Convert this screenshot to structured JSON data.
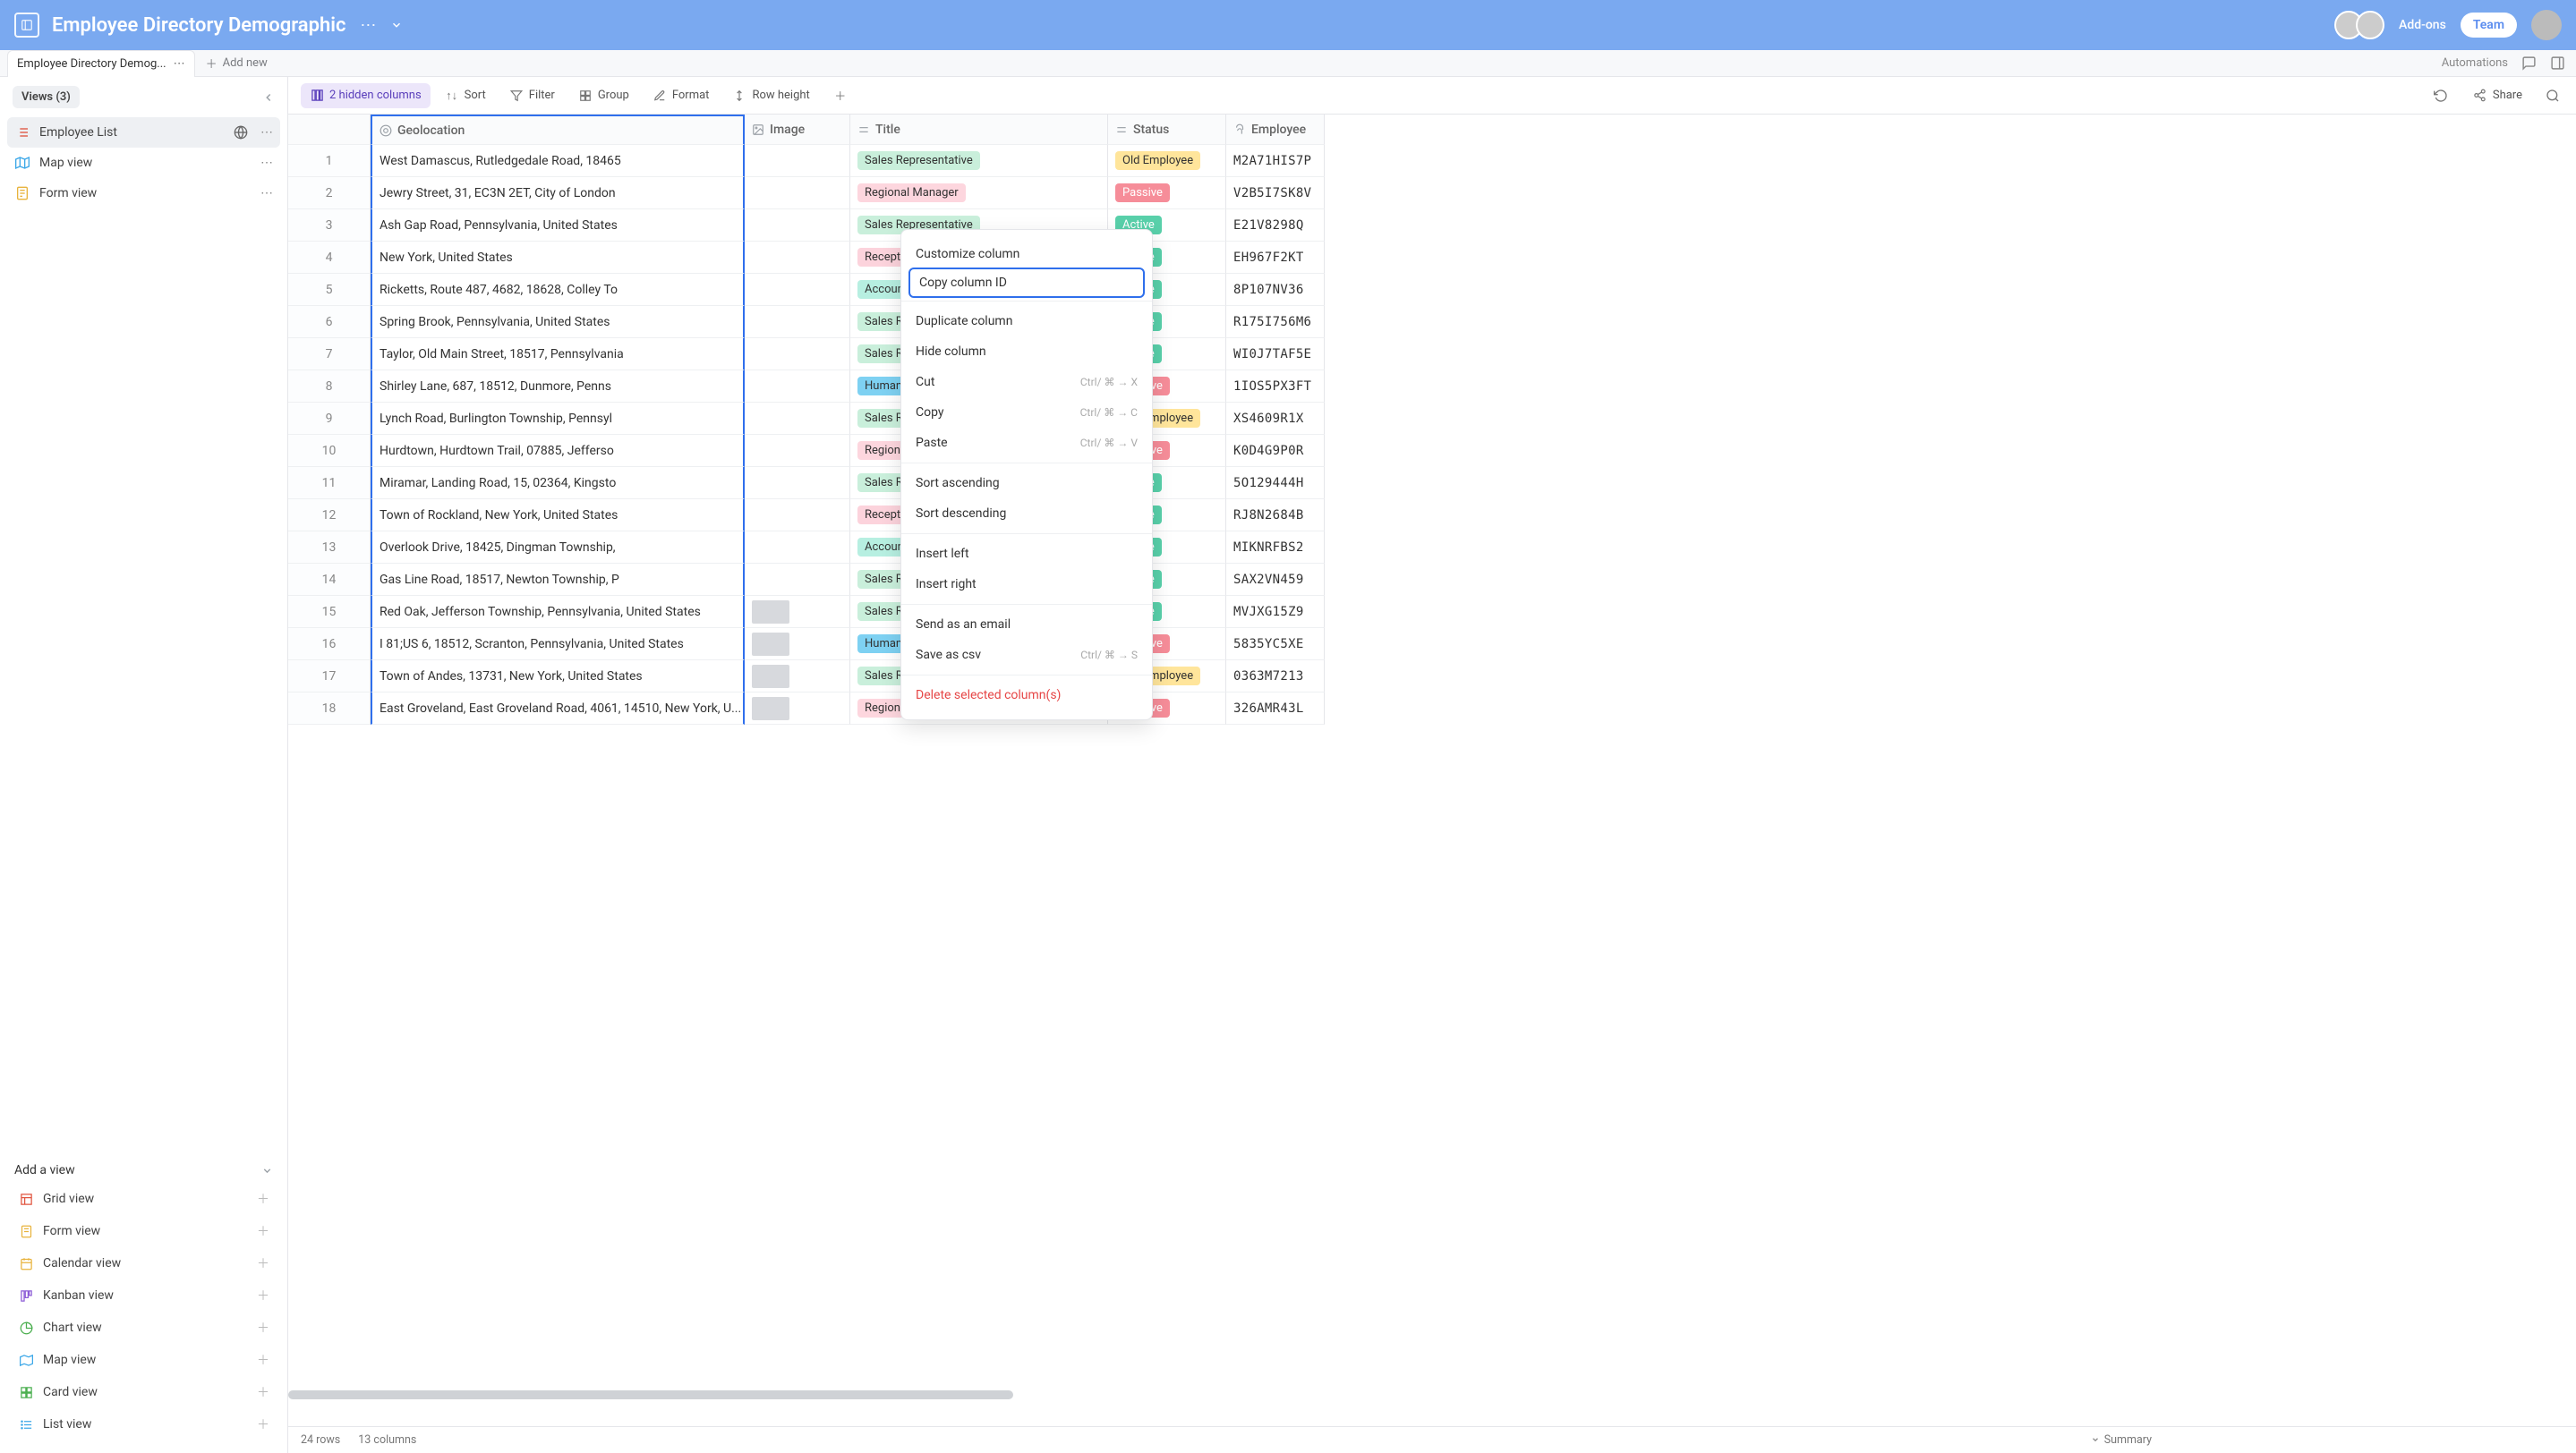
{
  "topbar": {
    "title": "Employee Directory Demographic",
    "addons": "Add-ons",
    "team": "Team"
  },
  "tabstrip": {
    "tab_name": "Employee Directory Demog...",
    "add_new": "Add new",
    "automations": "Automations"
  },
  "sidebar": {
    "views_label": "Views (3)",
    "items": [
      {
        "label": "Employee List"
      },
      {
        "label": "Map view"
      },
      {
        "label": "Form view"
      }
    ],
    "add_view_label": "Add a view",
    "add_view_items": [
      {
        "label": "Grid view"
      },
      {
        "label": "Form view"
      },
      {
        "label": "Calendar view"
      },
      {
        "label": "Kanban view"
      },
      {
        "label": "Chart view"
      },
      {
        "label": "Map view"
      },
      {
        "label": "Card view"
      },
      {
        "label": "List view"
      }
    ]
  },
  "toolbar": {
    "hidden": "2 hidden columns",
    "sort": "Sort",
    "filter": "Filter",
    "group": "Group",
    "format": "Format",
    "row_height": "Row height",
    "share": "Share"
  },
  "columns": {
    "c1": "Geolocation",
    "c2": "Image",
    "c3": "Title",
    "c4": "Status",
    "c5": "Employee"
  },
  "rows": [
    {
      "n": "1",
      "geo": "West Damascus, Rutledgedale Road, 18465",
      "title": "Sales Representative",
      "status": "Old Employee",
      "emp": "M2A71HIS7P"
    },
    {
      "n": "2",
      "geo": "Jewry Street, 31, EC3N 2ET, City of London",
      "title": "Regional Manager",
      "status": "Passive",
      "emp": "V2B5I7SK8V"
    },
    {
      "n": "3",
      "geo": "Ash Gap Road, Pennsylvania, United States",
      "title": "Sales Representative",
      "status": "Active",
      "emp": "E21V8298Q"
    },
    {
      "n": "4",
      "geo": "New York, United States",
      "title": "Receptionist",
      "status": "Active",
      "emp": "EH967F2KT"
    },
    {
      "n": "5",
      "geo": "Ricketts, Route 487, 4682, 18628, Colley To",
      "title": "Accountant",
      "status": "Active",
      "emp": "8P107NV36"
    },
    {
      "n": "6",
      "geo": "Spring Brook, Pennsylvania, United States",
      "title": "Sales Representative",
      "status": "Active",
      "emp": "R175I756M6"
    },
    {
      "n": "7",
      "geo": "Taylor, Old Main Street, 18517, Pennsylvania",
      "title": "Sales Representative",
      "status": "Active",
      "emp": "WI0J7TAF5E"
    },
    {
      "n": "8",
      "geo": "Shirley Lane, 687, 18512, Dunmore, Penns",
      "title": "Human Resources Representative",
      "status": "Passive",
      "emp": "1IOS5PX3FT"
    },
    {
      "n": "9",
      "geo": "Lynch Road, Burlington Township, Pennsyl",
      "title": "Sales Representative",
      "status": "Old Employee",
      "emp": "XS4609R1X"
    },
    {
      "n": "10",
      "geo": "Hurdtown, Hurdtown Trail, 07885, Jefferso",
      "title": "Regional Manager",
      "status": "Passive",
      "emp": "K0D4G9P0R"
    },
    {
      "n": "11",
      "geo": "Miramar, Landing Road, 15, 02364, Kingsto",
      "title": "Sales Representative",
      "status": "Active",
      "emp": "5O129444H"
    },
    {
      "n": "12",
      "geo": "Town of Rockland, New York, United States",
      "title": "Receptionist",
      "status": "Active",
      "emp": "RJ8N2684B"
    },
    {
      "n": "13",
      "geo": "Overlook Drive, 18425, Dingman Township,",
      "title": "Accountant",
      "status": "Active",
      "emp": "MIKNRFBS2"
    },
    {
      "n": "14",
      "geo": "Gas Line Road, 18517, Newton Township, P",
      "title": "Sales Representative",
      "status": "Active",
      "emp": "SAX2VN459"
    },
    {
      "n": "15",
      "geo": "Red Oak, Jefferson Township, Pennsylvania, United States",
      "title": "Sales Representative",
      "status": "Active",
      "emp": "MVJXG15Z9"
    },
    {
      "n": "16",
      "geo": "I 81;US 6, 18512, Scranton, Pennsylvania, United States",
      "title": "Human Resources Representative",
      "status": "Passive",
      "emp": "5835YC5XE"
    },
    {
      "n": "17",
      "geo": "Town of Andes, 13731, New York, United States",
      "title": "Sales Representative",
      "status": "Old Employee",
      "emp": "0363M7213"
    },
    {
      "n": "18",
      "geo": "East Groveland, East Groveland Road, 4061, 14510, New York, U...",
      "title": "Regional Manager",
      "status": "Passive",
      "emp": "326AMR43L"
    }
  ],
  "footer": {
    "rows": "24 rows",
    "cols": "13 columns",
    "summary": "Summary"
  },
  "ctx": {
    "customize": "Customize column",
    "copy_id": "Copy column ID",
    "duplicate": "Duplicate column",
    "hide": "Hide column",
    "cut": "Cut",
    "cut_sc": "Ctrl/ ⌘ → X",
    "copy": "Copy",
    "copy_sc": "Ctrl/ ⌘ → C",
    "paste": "Paste",
    "paste_sc": "Ctrl/ ⌘ → V",
    "sort_asc": "Sort ascending",
    "sort_desc": "Sort descending",
    "insert_left": "Insert left",
    "insert_right": "Insert right",
    "send_email": "Send as an email",
    "save_csv": "Save as csv",
    "save_csv_sc": "Ctrl/ ⌘ → S",
    "delete": "Delete selected column(s)"
  },
  "title_class": {
    "Sales Representative": "title-sales",
    "Regional Manager": "title-regional",
    "Receptionist": "title-recep",
    "Accountant": "title-account",
    "Human Resources Representative": "title-hr"
  },
  "status_class": {
    "Old Employee": "status-old",
    "Passive": "status-passive",
    "Active": "status-active"
  }
}
